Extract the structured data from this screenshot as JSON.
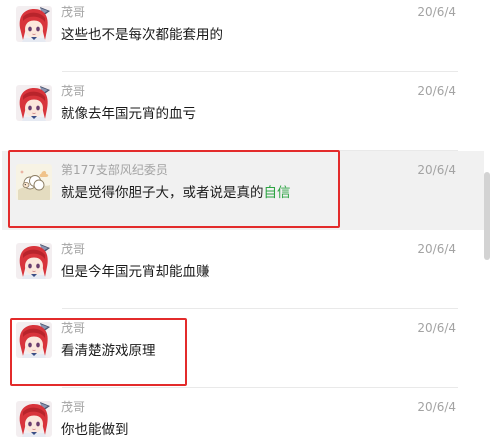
{
  "messages": [
    {
      "sender": "茂哥",
      "time": "20/6/4",
      "text": "这些也不是每次都能套用的",
      "avatar_icon": "anime-girl-avatar-icon"
    },
    {
      "sender": "茂哥",
      "time": "20/6/4",
      "text": "就像去年国元宵的血亏",
      "avatar_icon": "anime-girl-avatar-icon"
    },
    {
      "sender": "第177支部风纪委员",
      "time": "20/6/4",
      "text_main": "就是觉得你胆子大，或者说是真的",
      "text_highlight": "自信",
      "avatar_icon": "cartoon-sheep-avatar-icon"
    },
    {
      "sender": "茂哥",
      "time": "20/6/4",
      "text": "但是今年国元宵却能血赚",
      "avatar_icon": "anime-girl-avatar-icon"
    },
    {
      "sender": "茂哥",
      "time": "20/6/4",
      "text": "看清楚游戏原理",
      "avatar_icon": "anime-girl-avatar-icon"
    },
    {
      "sender": "茂哥",
      "time": "20/6/4",
      "text": "你也能做到",
      "avatar_icon": "anime-girl-avatar-icon"
    }
  ],
  "colors": {
    "highlight_box": "#e32b2b",
    "green_text": "#2ca342",
    "meta_text": "#a3a3a3",
    "selected_row_bg": "#f1f1f1"
  }
}
